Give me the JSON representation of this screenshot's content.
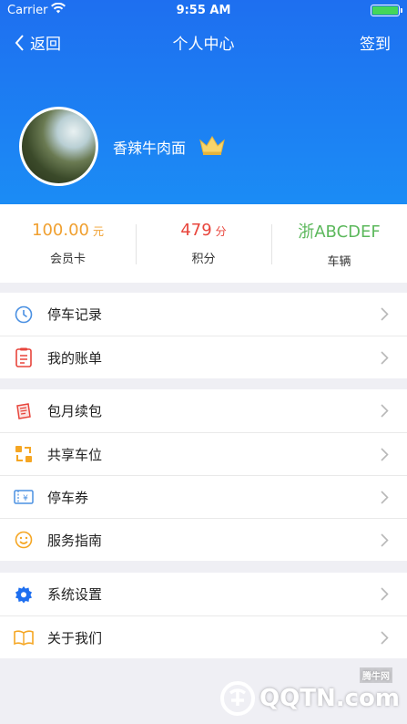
{
  "status_bar": {
    "carrier": "Carrier",
    "time": "9:55 AM"
  },
  "nav": {
    "back_label": "返回",
    "title": "个人中心",
    "signin_label": "签到"
  },
  "profile": {
    "username": "香辣牛肉面"
  },
  "stats": [
    {
      "value": "100.00",
      "unit": "元",
      "label": "会员卡",
      "color": "#f0a030"
    },
    {
      "value": "479",
      "unit": "分",
      "label": "积分",
      "color": "#e8453c"
    },
    {
      "value": "浙ABCDEF",
      "unit": "",
      "label": "车辆",
      "color": "#5cb85c"
    }
  ],
  "menu_groups": [
    {
      "items": [
        {
          "label": "停车记录",
          "icon": "clock-icon",
          "color": "#4a90e2"
        },
        {
          "label": "我的账单",
          "icon": "bill-icon",
          "color": "#e8453c"
        }
      ]
    },
    {
      "items": [
        {
          "label": "包月续包",
          "icon": "ticket-icon",
          "color": "#e8453c"
        },
        {
          "label": "共享车位",
          "icon": "share-icon",
          "color": "#f5a623"
        },
        {
          "label": "停车券",
          "icon": "coupon-icon",
          "color": "#4a90e2"
        },
        {
          "label": "服务指南",
          "icon": "smile-icon",
          "color": "#f5a623"
        }
      ]
    },
    {
      "items": [
        {
          "label": "系统设置",
          "icon": "gear-icon",
          "color": "#1e6ff0"
        },
        {
          "label": "关于我们",
          "icon": "book-icon",
          "color": "#f5a623"
        }
      ]
    }
  ],
  "watermark": {
    "text": "QQTN.com",
    "small": "腾牛网"
  }
}
